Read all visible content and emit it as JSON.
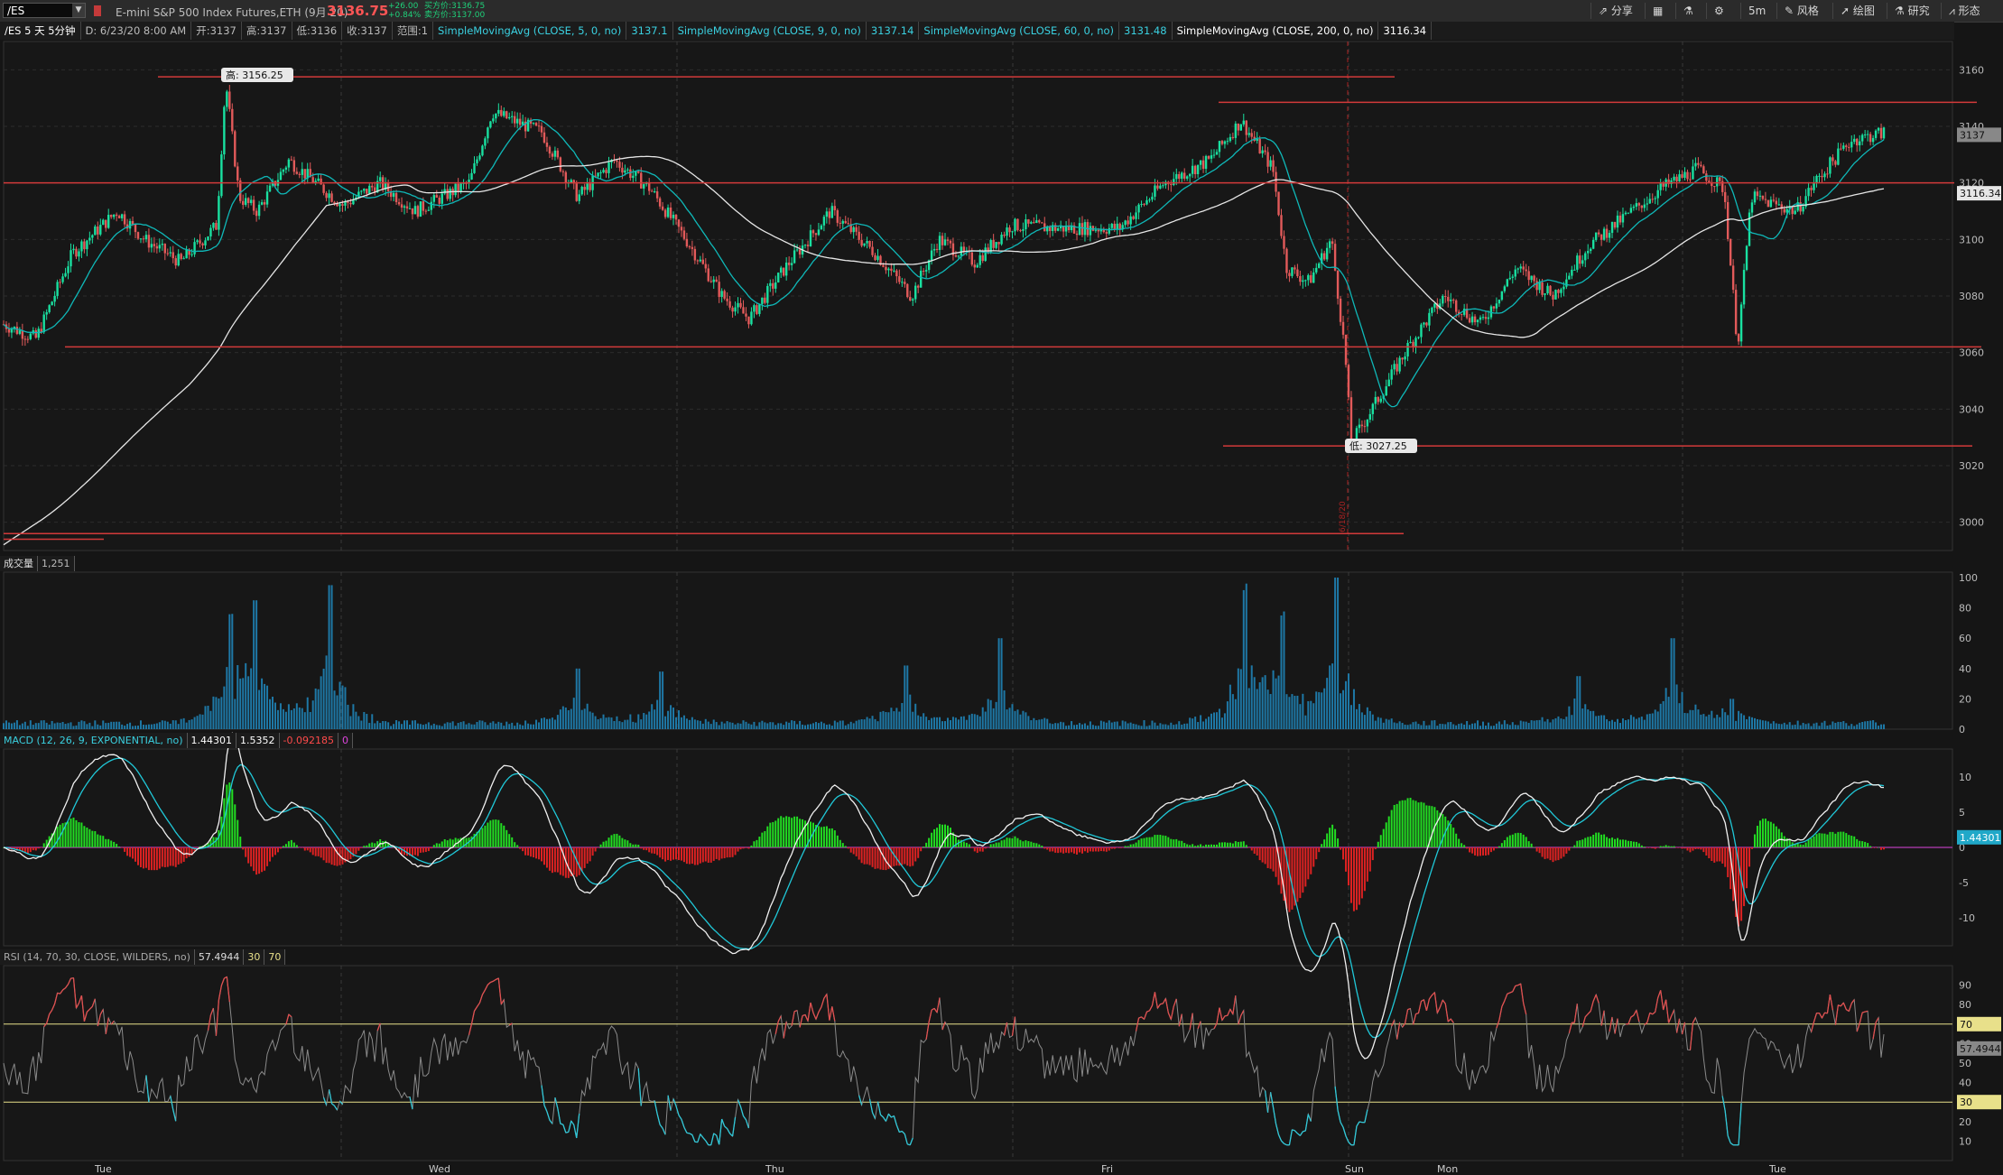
{
  "toolbar": {
    "symbol": "/ES",
    "description": "E-mini S&P 500 Index Futures,ETH (9月 20)",
    "last_price": "3136.75",
    "change": "+26.00",
    "change_pct": "+0.84%",
    "bid": "买方价:3136.75",
    "ask": "卖方价:3137.00",
    "buttons": [
      "分享",
      "",
      "",
      "",
      "5m",
      "风格",
      "绘图",
      "研究",
      "形态"
    ]
  },
  "infobar": {
    "items": [
      "/ES 5 天 5分钟",
      "D: 6/23/20 8:00 AM",
      "开:3137",
      "高:3137",
      "低:3136",
      "收:3137",
      "范围:1",
      "SimpleMovingAvg (CLOSE, 5, 0, no)",
      "3137.1",
      "SimpleMovingAvg (CLOSE, 9, 0, no)",
      "3137.14",
      "SimpleMovingAvg (CLOSE, 60, 0, no)",
      "3131.48",
      "SimpleMovingAvg (CLOSE, 200, 0, no)",
      "3116.34"
    ]
  },
  "price_panel": {
    "y_ticks": [
      "3160",
      "3140",
      "3120",
      "3100",
      "3080",
      "3060",
      "3040",
      "3020",
      "3000"
    ],
    "high_label": "高: 3156.25",
    "low_label": "低: 3027.25",
    "price_tag_last": "3137",
    "price_tag_sma200": "3116.34",
    "vline_label": "6/18/20"
  },
  "volume_panel": {
    "labels": [
      "成交量",
      "1,251"
    ],
    "y_ticks": [
      "100",
      "80",
      "60",
      "40",
      "20",
      "0"
    ]
  },
  "macd_panel": {
    "labels": [
      "MACD (12, 26, 9, EXPONENTIAL, no)",
      "1.44301",
      "1.5352",
      "-0.092185",
      "0"
    ],
    "y_ticks": [
      "10",
      "5",
      "0",
      "-5",
      "-10"
    ],
    "value_tag": "1.44301"
  },
  "rsi_panel": {
    "labels": [
      "RSI (14, 70, 30, CLOSE, WILDERS, no)",
      "57.4944",
      "30",
      "70"
    ],
    "y_ticks": [
      "90",
      "80",
      "70",
      "60",
      "50",
      "40",
      "30",
      "20",
      "10"
    ],
    "tag_70": "70",
    "tag_value": "57.4944",
    "tag_30": "30"
  },
  "x_axis": {
    "labels": [
      "Tue",
      "Wed",
      "Thu",
      "Fri",
      "Sun",
      "Mon",
      "Tue"
    ]
  },
  "colors": {
    "background": "#151515",
    "up_candle": "#19e0a0",
    "down_candle": "#e25a5a",
    "sma5": "#0fb8b8",
    "sma200": "#e6e6e6",
    "support_line": "#d23a3a",
    "volume": "#1e78a6",
    "macd_pos": "#22dd22",
    "macd_neg": "#dd2222",
    "rsi_line": "#8a8a8a",
    "rsi_band": "#e8e08a"
  }
}
